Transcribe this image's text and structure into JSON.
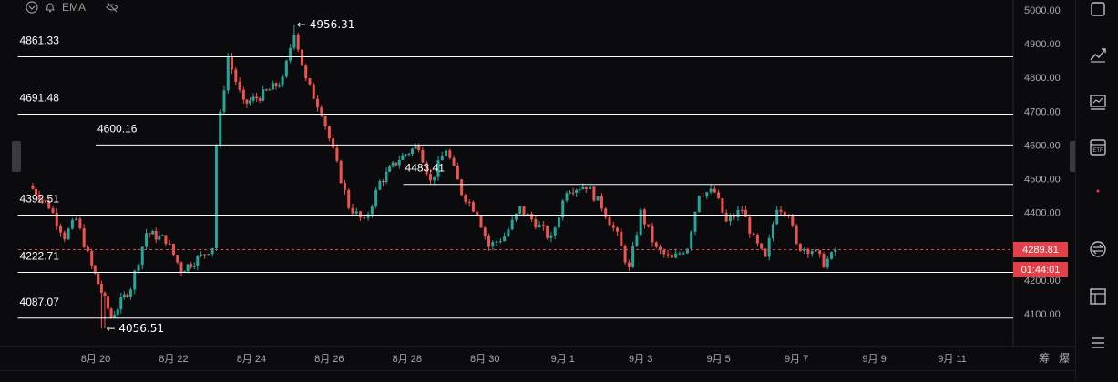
{
  "indicator": {
    "label": "EMA"
  },
  "colors": {
    "up": "#26a69a",
    "down": "#ef5350",
    "line": "#ffffff",
    "grid": "#1a1a1e",
    "axis_text": "#a8a8a8",
    "price_tag": "#e2414a"
  },
  "current_price": {
    "value": 4289.81,
    "label": "4289.81",
    "countdown": "01:44:01"
  },
  "toolbar": {
    "icons": [
      "calendar-icon",
      "line-chart-icon",
      "indicator-panel-icon",
      "etf-icon",
      "swap-icon",
      "layout-icon",
      "list-icon"
    ]
  },
  "chart_data": {
    "type": "candlestick",
    "y_axis": {
      "min": 4050,
      "max": 5010,
      "ticks": [
        5000,
        4900,
        4800,
        4700,
        4600,
        4500,
        4400,
        4300,
        4200,
        4100
      ],
      "tick_labels": [
        "5000.00",
        "4900.00",
        "4800.00",
        "4700.00",
        "4600.00",
        "4500.00",
        "4400.00",
        "4300.00",
        "4200.00",
        "4100.00"
      ]
    },
    "x_axis": {
      "labels": [
        "8月 20",
        "8月 22",
        "8月 24",
        "8月 26",
        "8月 28",
        "8月 30",
        "9月 1",
        "9月 3",
        "9月 5",
        "9月 7",
        "9月 9",
        "9月 11"
      ],
      "days": [
        20,
        22,
        24,
        26,
        28,
        30,
        32,
        34,
        36,
        38,
        40,
        42
      ]
    },
    "bottom_right_labels": [
      "筹",
      "爆"
    ],
    "horizontal_levels": [
      {
        "value": 4861.33,
        "label": "4861.33",
        "from_day": 18
      },
      {
        "value": 4691.48,
        "label": "4691.48",
        "from_day": 18
      },
      {
        "value": 4600.16,
        "label": "4600.16",
        "from_day": 20
      },
      {
        "value": 4483.41,
        "label": "4483.41",
        "from_day": 27.9
      },
      {
        "value": 4392.51,
        "label": "4392.51",
        "from_day": 18
      },
      {
        "value": 4222.71,
        "label": "4222.71",
        "from_day": 18
      },
      {
        "value": 4087.07,
        "label": "4087.07",
        "from_day": 18
      }
    ],
    "annotations": [
      {
        "text": "← 4956.31",
        "day": 25.1,
        "value": 4956.31
      },
      {
        "text": "← 4056.51",
        "day": 20.2,
        "value": 4056.51
      }
    ],
    "path": [
      [
        18.3,
        4480
      ],
      [
        18.8,
        4420
      ],
      [
        19.2,
        4330
      ],
      [
        19.5,
        4380
      ],
      [
        19.9,
        4240
      ],
      [
        20.4,
        4090
      ],
      [
        20.9,
        4180
      ],
      [
        21.3,
        4340
      ],
      [
        21.8,
        4320
      ],
      [
        22.2,
        4230
      ],
      [
        22.7,
        4270
      ],
      [
        23.0,
        4300
      ],
      [
        23.1,
        4600
      ],
      [
        23.4,
        4860
      ],
      [
        23.8,
        4720
      ],
      [
        24.3,
        4750
      ],
      [
        24.8,
        4790
      ],
      [
        25.1,
        4940
      ],
      [
        25.4,
        4790
      ],
      [
        25.8,
        4700
      ],
      [
        26.1,
        4580
      ],
      [
        26.5,
        4420
      ],
      [
        26.9,
        4370
      ],
      [
        27.3,
        4490
      ],
      [
        27.8,
        4560
      ],
      [
        28.3,
        4600
      ],
      [
        28.6,
        4490
      ],
      [
        29.0,
        4590
      ],
      [
        29.4,
        4460
      ],
      [
        29.8,
        4400
      ],
      [
        30.1,
        4300
      ],
      [
        30.5,
        4330
      ],
      [
        30.9,
        4410
      ],
      [
        31.3,
        4370
      ],
      [
        31.7,
        4320
      ],
      [
        32.1,
        4470
      ],
      [
        32.6,
        4480
      ],
      [
        33.0,
        4420
      ],
      [
        33.4,
        4330
      ],
      [
        33.7,
        4230
      ],
      [
        34.0,
        4400
      ],
      [
        34.4,
        4290
      ],
      [
        34.8,
        4260
      ],
      [
        35.2,
        4300
      ],
      [
        35.5,
        4460
      ],
      [
        35.9,
        4460
      ],
      [
        36.2,
        4370
      ],
      [
        36.6,
        4410
      ],
      [
        36.9,
        4320
      ],
      [
        37.2,
        4260
      ],
      [
        37.5,
        4420
      ],
      [
        37.8,
        4400
      ],
      [
        38.0,
        4300
      ],
      [
        38.4,
        4290
      ],
      [
        38.7,
        4250
      ],
      [
        38.9,
        4270
      ],
      [
        39.0,
        4290
      ]
    ]
  }
}
